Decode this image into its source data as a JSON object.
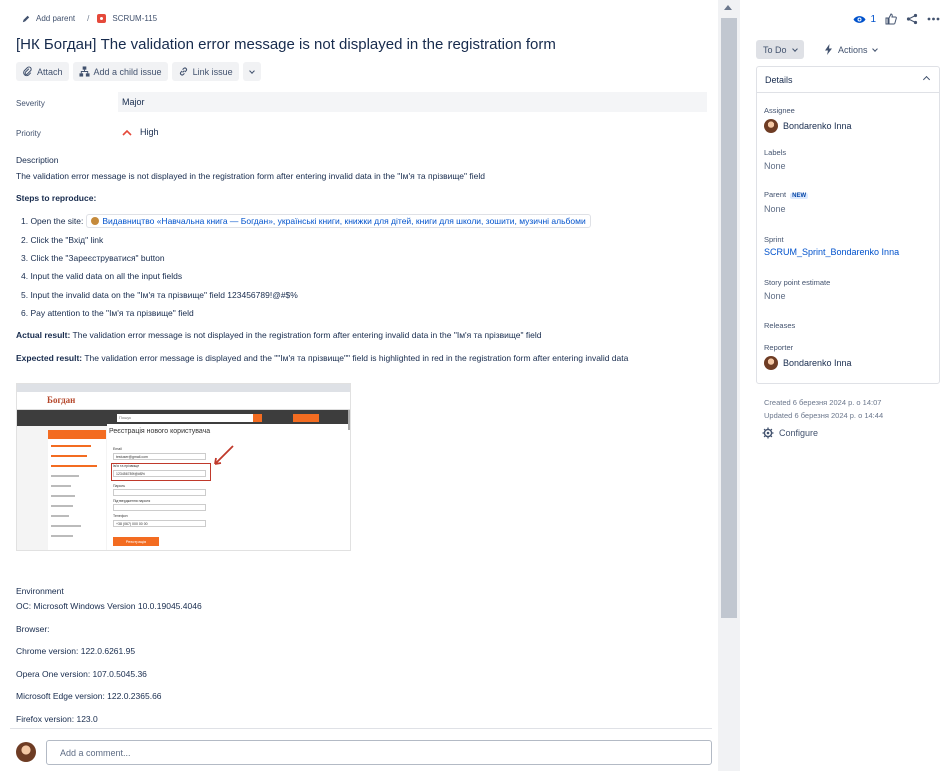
{
  "breadcrumb": {
    "add_parent": "Add parent",
    "separator": "/",
    "issue_key": "SCRUM-115"
  },
  "issue": {
    "title": "[НК Богдан] The validation error message is not displayed in the registration form"
  },
  "toolbar": {
    "attach": "Attach",
    "add_child": "Add a child issue",
    "link_issue": "Link issue"
  },
  "fields": {
    "severity_label": "Severity",
    "severity_value": "Major",
    "priority_label": "Priority",
    "priority_value": "High"
  },
  "description": {
    "heading": "Description",
    "summary": "The validation error message is not displayed in the registration form after entering invalid data in the \"Ім'я та прізвище\" field",
    "steps_heading": "Steps to reproduce:",
    "step1_prefix": "1. Open the site:",
    "step1_link": "Видавництво «Навчальна книга — Богдан», українські книги, книжки для дітей, книги для школи, зошити, музичні альбоми",
    "step2": "2. Click the \"Вхід\" link",
    "step3": "3. Click the \"Зареєструватися\" button",
    "step4": "4. Input the valid data on all the input fields",
    "step5": "5. Input the invalid data on the \"Ім'я та прізвище\" field 123456789!@#$%",
    "step6": "6. Pay attention to the \"Ім'я та прізвище\" field",
    "actual_label": "Actual result:",
    "actual_text": " The validation error message is not displayed in the registration form after entering invalid data in the \"Ім'я та прізвище\" field",
    "expected_label": "Expected result:",
    "expected_text": " The validation error message is displayed and the \"\"Ім'я та прізвище\"\" field is highlighted in red in the registration form after entering invalid data"
  },
  "screenshot": {
    "logo": "Богдан",
    "search_placeholder": "Пошук",
    "page_heading": "Реєстрація нового користувача",
    "email_label": "Email",
    "email_value": "testuser@gmail.com",
    "name_label": "Ім'я та прізвище",
    "name_value": "123456789!@#$%",
    "password_label": "Пароль",
    "password_confirm_label": "Підтвердження пароля",
    "phone_label": "Телефон",
    "phone_value": "+38 (067) 000 00 00",
    "submit": "Реєстрація",
    "menu": [
      "Каталог товарів",
      "Новинки",
      "Знижки до -50%",
      "Акційні пропозиції до 30%",
      "Книги",
      "Зошити",
      "Альбоми",
      "Плакати",
      "Подарунки",
      "Розпродаж"
    ]
  },
  "environment": {
    "heading": "Environment",
    "os": "ОС: Microsoft Windows Version 10.0.19045.4046",
    "browser_label": "Browser:",
    "chrome": "Chrome version: 122.0.6261.95",
    "opera": "Opera One version: 107.0.5045.36",
    "edge": "Microsoft Edge  version: 122.0.2365.66",
    "firefox": "Firefox version: 123.0"
  },
  "comment": {
    "placeholder": "Add a comment..."
  },
  "side": {
    "watch_count": "1",
    "status": "To Do",
    "actions": "Actions",
    "details_heading": "Details",
    "assignee_label": "Assignee",
    "assignee": "Bondarenko Inna",
    "labels_label": "Labels",
    "labels_value": "None",
    "parent_label": "Parent",
    "parent_badge": "NEW",
    "parent_value": "None",
    "sprint_label": "Sprint",
    "sprint_value": "SCRUM_Sprint_Bondarenko Inna",
    "story_label": "Story point estimate",
    "story_value": "None",
    "releases_label": "Releases",
    "reporter_label": "Reporter",
    "reporter": "Bondarenko Inna",
    "created": "Created 6 березня 2024 р. о 14:07",
    "updated": "Updated 6 березня 2024 р. о 14:44",
    "configure": "Configure"
  },
  "colors": {
    "link": "#0052cc",
    "bug": "#e5493a",
    "priority_high": "#e5493a",
    "site_orange": "#f36c21"
  }
}
